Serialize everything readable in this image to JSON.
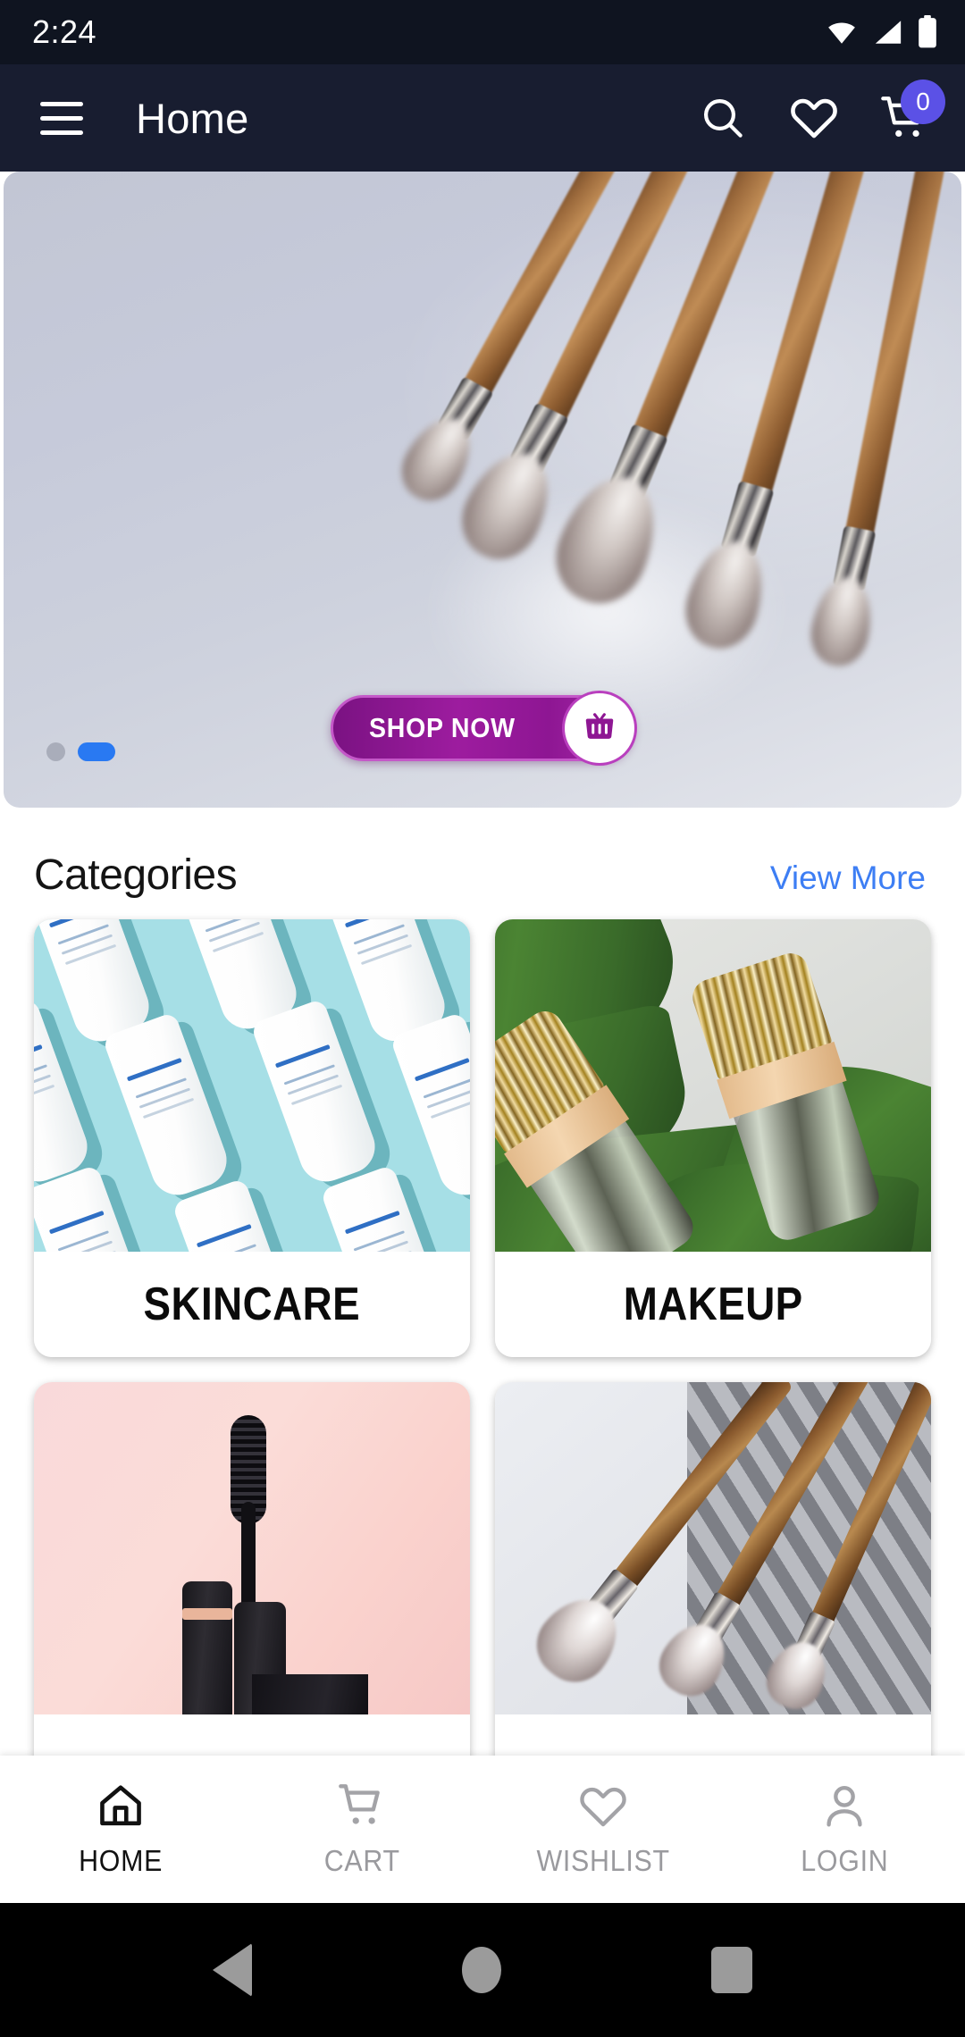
{
  "status_bar": {
    "time": "2:24",
    "icons": [
      "wifi-icon",
      "cellular-signal-icon",
      "battery-icon"
    ]
  },
  "app_bar": {
    "menu_icon": "hamburger-menu-icon",
    "title": "Home",
    "actions": [
      {
        "name": "search-icon",
        "label": "Search"
      },
      {
        "name": "wishlist-heart-icon",
        "label": "Wishlist"
      },
      {
        "name": "cart-icon",
        "label": "Cart"
      }
    ],
    "cart_badge_count": "0",
    "background_color": "#181d30",
    "badge_color": "#5b51e6"
  },
  "banner": {
    "cta_label": "SHOP NOW",
    "cta_icon": "shopping-basket-icon",
    "slides_total": 2,
    "active_slide": 2,
    "image_description": "makeup brushes"
  },
  "categories_section": {
    "title": "Categories",
    "view_more_label": "View More",
    "view_more_color": "#3d7ef4",
    "items": [
      {
        "label": "SKINCARE",
        "art": "skincare"
      },
      {
        "label": "MAKEUP",
        "art": "makeup"
      },
      {
        "label": "",
        "art": "mascara"
      },
      {
        "label": "",
        "art": "brushes"
      }
    ]
  },
  "bottom_nav": {
    "items": [
      {
        "label": "HOME",
        "icon": "home-icon",
        "active": true
      },
      {
        "label": "CART",
        "icon": "cart-icon",
        "active": false
      },
      {
        "label": "WISHLIST",
        "icon": "heart-icon",
        "active": false
      },
      {
        "label": "LOGIN",
        "icon": "person-icon",
        "active": false
      }
    ]
  },
  "android_nav": {
    "back": "back-triangle-icon",
    "home": "home-circle-icon",
    "recent": "recent-apps-square-icon"
  }
}
